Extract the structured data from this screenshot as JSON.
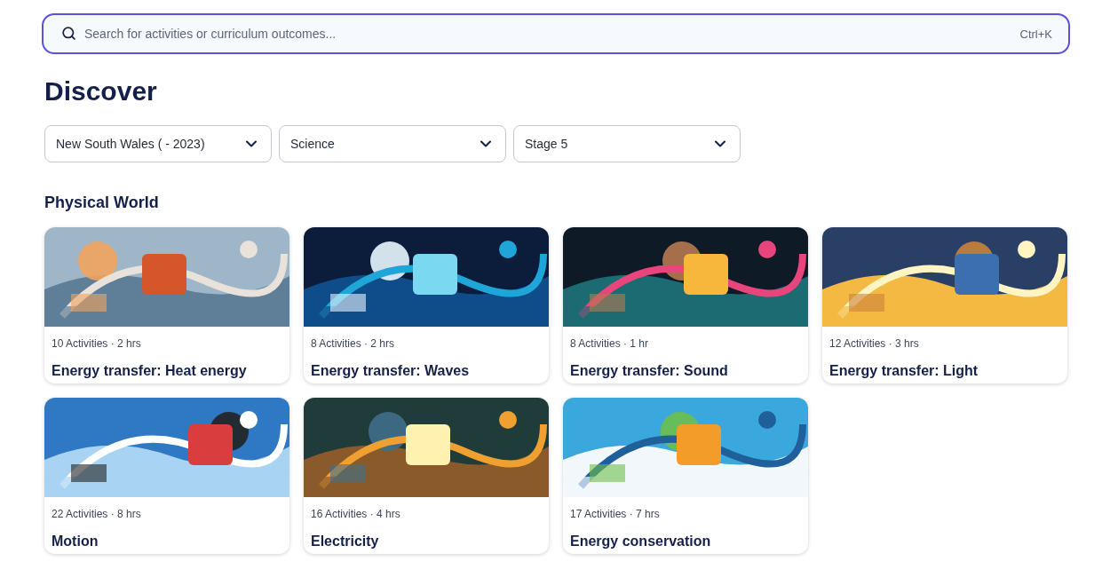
{
  "search": {
    "placeholder": "Search for activities or curriculum outcomes...",
    "shortcut": "Ctrl+K"
  },
  "title": "Discover",
  "filters": [
    {
      "value": "New South Wales ( - 2023)"
    },
    {
      "value": "Science"
    },
    {
      "value": "Stage 5"
    }
  ],
  "section": {
    "title": "Physical World",
    "cards": [
      {
        "meta": "10 Activities · 2 hrs",
        "title": "Energy transfer: Heat energy"
      },
      {
        "meta": "8 Activities · 2 hrs",
        "title": "Energy transfer: Waves"
      },
      {
        "meta": "8 Activities · 1 hr",
        "title": "Energy transfer: Sound"
      },
      {
        "meta": "12 Activities · 3 hrs",
        "title": "Energy transfer: Light"
      },
      {
        "meta": "22 Activities · 8 hrs",
        "title": "Motion"
      },
      {
        "meta": "16 Activities · 4 hrs",
        "title": "Electricity"
      },
      {
        "meta": "17 Activities · 7 hrs",
        "title": "Energy conservation"
      }
    ]
  }
}
